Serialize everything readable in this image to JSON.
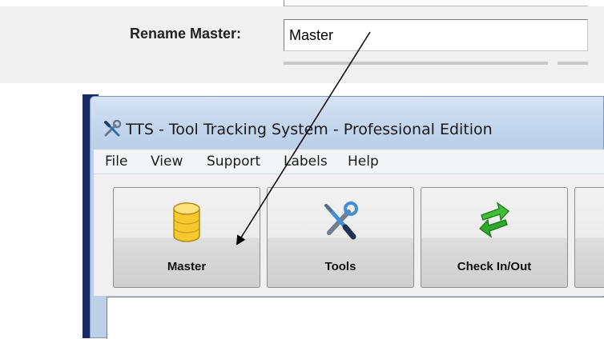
{
  "rename": {
    "label": "Rename Master:",
    "value": "Master"
  },
  "window": {
    "title": "TTS - Tool Tracking System - Professional Edition",
    "icon": "tools-wrench-screwdriver-icon"
  },
  "menu": [
    "File",
    "View",
    "Support",
    "Labels",
    "Help"
  ],
  "toolbar": {
    "buttons": [
      {
        "label": "Master",
        "icon": "database-cylinder-icon"
      },
      {
        "label": "Tools",
        "icon": "tools-icon"
      },
      {
        "label": "Check In/Out",
        "icon": "swap-arrows-icon"
      }
    ]
  },
  "colors": {
    "database_yellow": "#f7d23c",
    "swap_green": "#2fa72a",
    "tools_blue": "#3f8fd8"
  }
}
